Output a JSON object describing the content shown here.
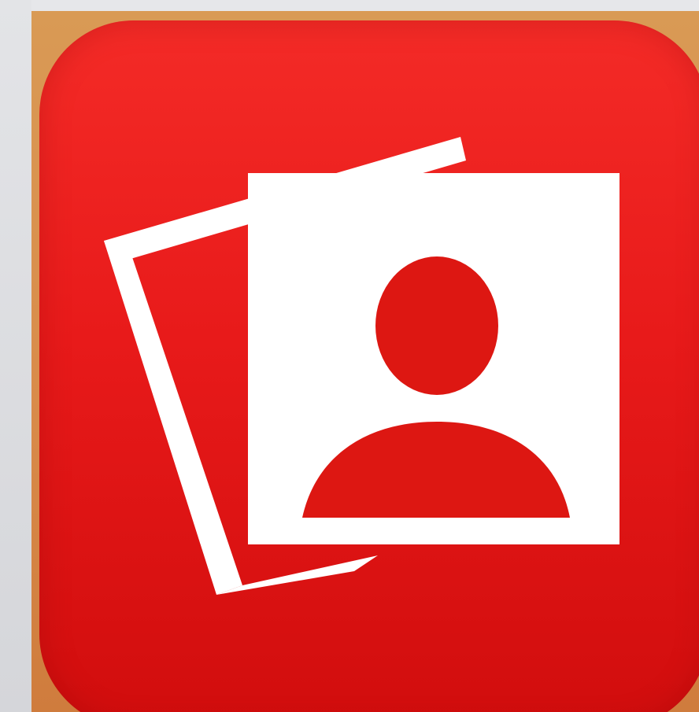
{
  "icon": {
    "name": "photo-booth-app-icon",
    "colors": {
      "background": "#d8d9dc",
      "frame": "#d98b4a",
      "tile_top": "#f42b27",
      "tile_bottom": "#d10d0d",
      "foreground": "#ffffff",
      "figure": "#dd1712"
    }
  }
}
